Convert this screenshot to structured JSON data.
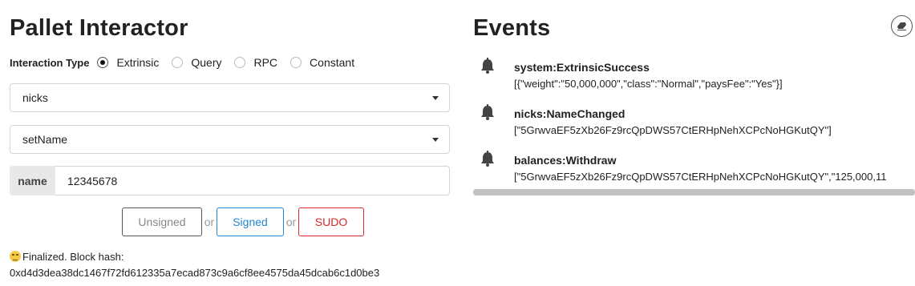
{
  "left": {
    "title": "Pallet Interactor",
    "interaction_type": {
      "label": "Interaction Type",
      "options": [
        {
          "label": "Extrinsic",
          "selected": true
        },
        {
          "label": "Query",
          "selected": false
        },
        {
          "label": "RPC",
          "selected": false
        },
        {
          "label": "Constant",
          "selected": false
        }
      ]
    },
    "pallet_value": "nicks",
    "call_value": "setName",
    "param": {
      "label": "name",
      "value": "12345678"
    },
    "buttons": {
      "unsigned": "Unsigned",
      "or": "or",
      "signed": "Signed",
      "sudo": "SUDO"
    },
    "status": {
      "line1": "Finalized. Block hash:",
      "hash": "0xd4d3dea38dc1467f72fd612335a7ecad873c9a6cf8ee4575da45dcab6c1d0be3",
      "emoji_icon": "smirk-emoji-icon"
    }
  },
  "right": {
    "title": "Events",
    "clear_icon": "eraser-icon",
    "events": [
      {
        "title": "system:ExtrinsicSuccess",
        "data": "[{\"weight\":\"50,000,000\",\"class\":\"Normal\",\"paysFee\":\"Yes\"}]",
        "icon": "bell-icon"
      },
      {
        "title": "nicks:NameChanged",
        "data": "[\"5GrwvaEF5zXb26Fz9rcQpDWS57CtERHpNehXCPcNoHGKutQY\"]",
        "icon": "bell-icon"
      },
      {
        "title": "balances:Withdraw",
        "data": "[\"5GrwvaEF5zXb26Fz9rcQpDWS57CtERHpNehXCPcNoHGKutQY\",\"125,000,11",
        "icon": "bell-icon"
      }
    ]
  },
  "colors": {
    "signed": "#2185d0",
    "sudo": "#db2828",
    "unsigned": "#555555"
  }
}
